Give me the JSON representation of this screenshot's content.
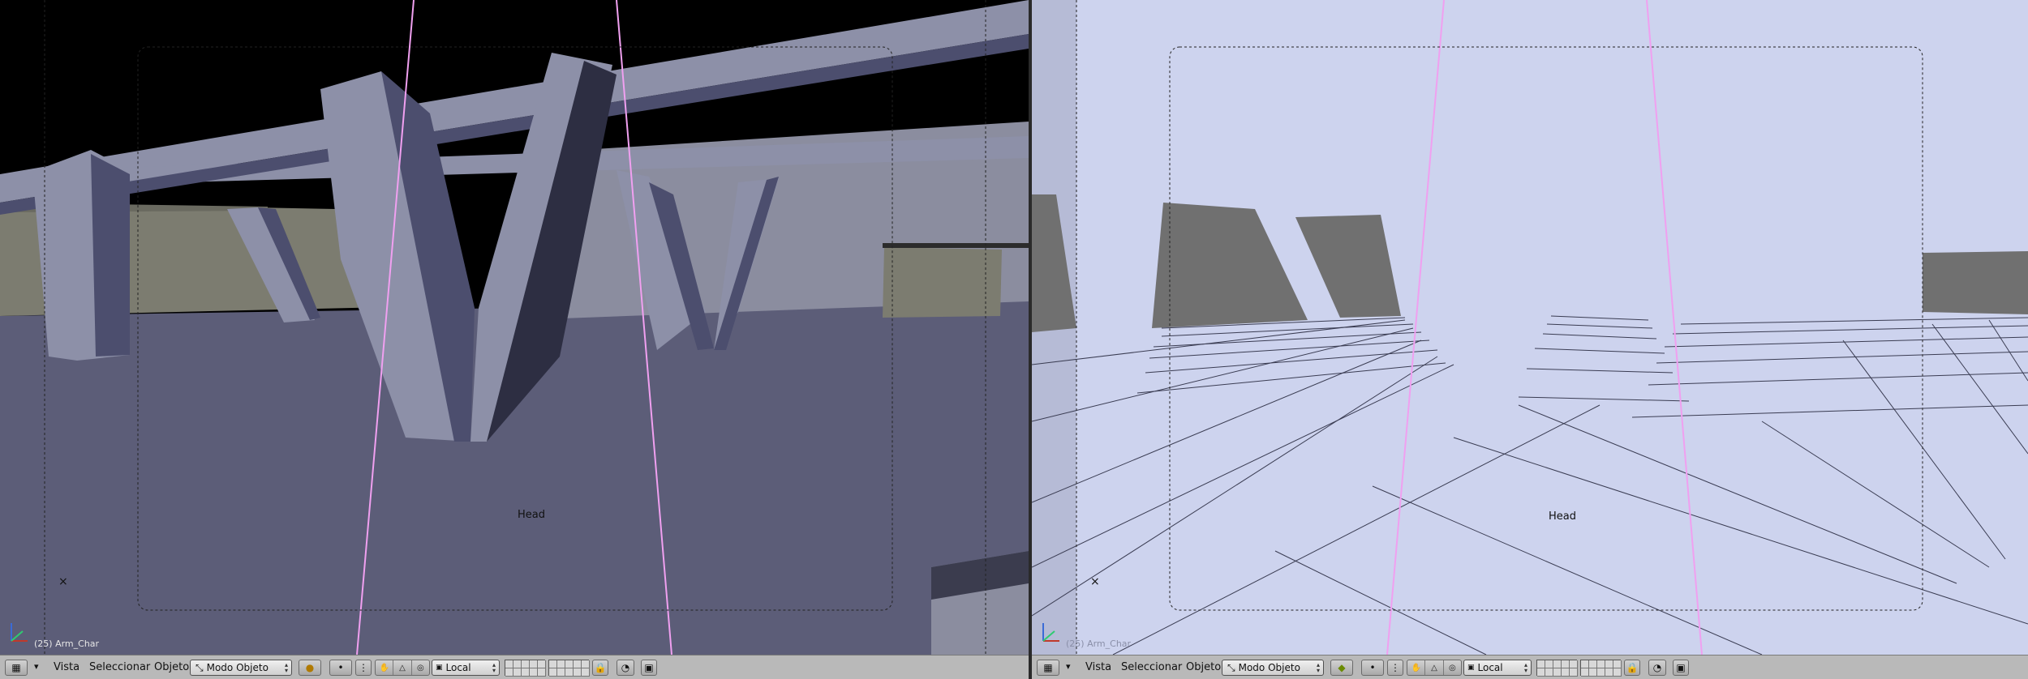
{
  "left_viewport": {
    "overlay_label": "Head",
    "cursor_marker": "×",
    "object_info": "(25) Arm_Char",
    "colors": {
      "sky": "#000000",
      "floor": "#5c5d78",
      "beams": "#8d90a8",
      "beam_shade": "#4c4e6e",
      "walls": "#7c7c70",
      "guides": "#f0a0f0"
    }
  },
  "right_viewport": {
    "overlay_label": "Head",
    "cursor_marker": "×",
    "object_info": "(25) Arm_Char",
    "colors": {
      "background": "#cdd3ee",
      "walls": "#707070",
      "grid_lines": "#3a3c52",
      "guides": "#f0a0f0"
    }
  },
  "header_left": {
    "editor_icon": "grid-icon",
    "menus": [
      "Vista",
      "Seleccionar",
      "Objeto"
    ],
    "mode": "Modo Objeto",
    "shading_icon": "shading-icon",
    "pivot_icon": "pivot-icon",
    "transform_icons": [
      "hand-icon",
      "triangle-icon",
      "circle-icon"
    ],
    "orientation": "Local",
    "lock_icon": "lock-icon",
    "render_icon": "render-icon"
  },
  "header_right": {
    "editor_icon": "grid-icon",
    "menus": [
      "Vista",
      "Seleccionar",
      "Objeto"
    ],
    "mode": "Modo Objeto",
    "shading_icon": "shading-icon",
    "pivot_icon": "pivot-icon",
    "transform_icons": [
      "hand-icon",
      "triangle-icon",
      "circle-icon"
    ],
    "orientation": "Local",
    "lock_icon": "lock-icon",
    "render_icon": "render-icon"
  }
}
